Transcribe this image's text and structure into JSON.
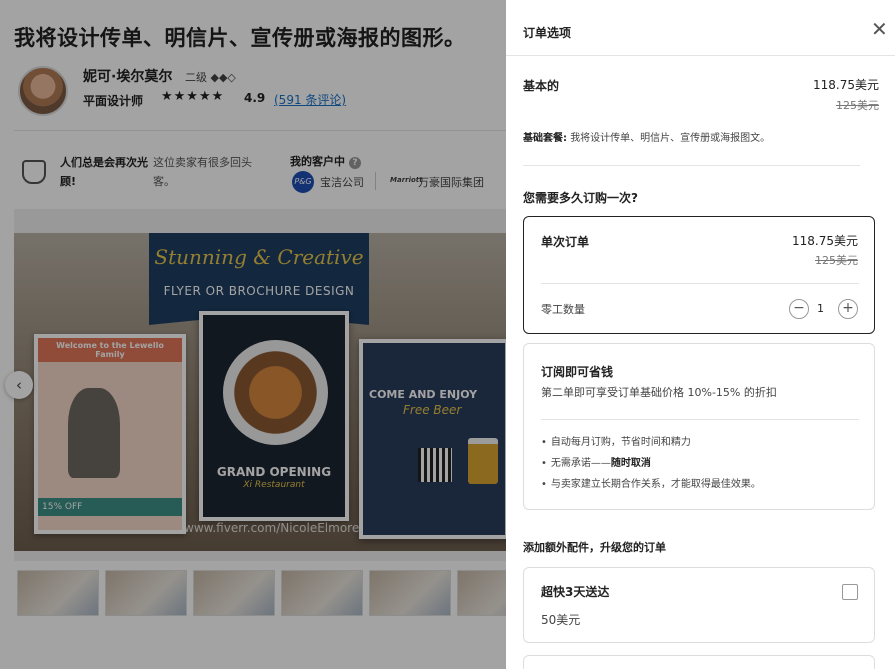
{
  "gig": {
    "title": "我将设计传单、明信片、宣传册或海报的图形。",
    "seller": {
      "name": "妮可·埃尔莫尔",
      "level": "二级 ◆◆◇",
      "role": "平面设计师",
      "stars": "★★★★★",
      "rating": "4.9",
      "reviews": "(591 条评论)"
    },
    "reputation": {
      "title": "人们总是会再次光顾!",
      "desc": "这位卖家有很多回头客。"
    },
    "clients": {
      "label": "我的客户中",
      "pg_logo": "P&G",
      "client1": "宝洁公司",
      "marriott_logo": "Marriott",
      "client2": "万豪国际集团"
    },
    "gallery": {
      "script_title": "Stunning & Creative",
      "subtitle": "FLYER OR BROCHURE DESIGN",
      "card1_header": "Welcome to the Lewello Family",
      "card1_footer": "15% OFF",
      "card2_title": "GRAND OPENING",
      "card2_sub": "Xi Restaurant",
      "card3_title": "COME AND ENJOY",
      "card3_sub": "Free Beer",
      "watermark": "www.fiverr.com/NicoleElmore"
    }
  },
  "panel": {
    "title": "订单选项",
    "close": "✕",
    "package": {
      "name": "基本的",
      "price": "118.75美元",
      "old_price": "125美元",
      "desc_label": "基础套餐:",
      "desc": "我将设计传单、明信片、宣传册或海报图文。"
    },
    "frequency_title": "您需要多久订购一次?",
    "single": {
      "name": "单次订单",
      "price": "118.75美元",
      "old_price": "125美元",
      "qty_label": "零工数量",
      "qty": "1",
      "minus": "−",
      "plus": "+"
    },
    "subscribe": {
      "title": "订阅即可省钱",
      "desc": "第二单即可享受订单基础价格 10%-15% 的折扣",
      "bullet1": "自动每月订购，节省时间和精力",
      "bullet2_prefix": "无需承诺——",
      "bullet2_bold": "随时取消",
      "bullet3": "与卖家建立长期合作关系，才能取得最佳效果。"
    },
    "extras_title": "添加额外配件，升级您的订单",
    "extra1": {
      "name": "超快3天送达",
      "price": "50美元"
    }
  }
}
